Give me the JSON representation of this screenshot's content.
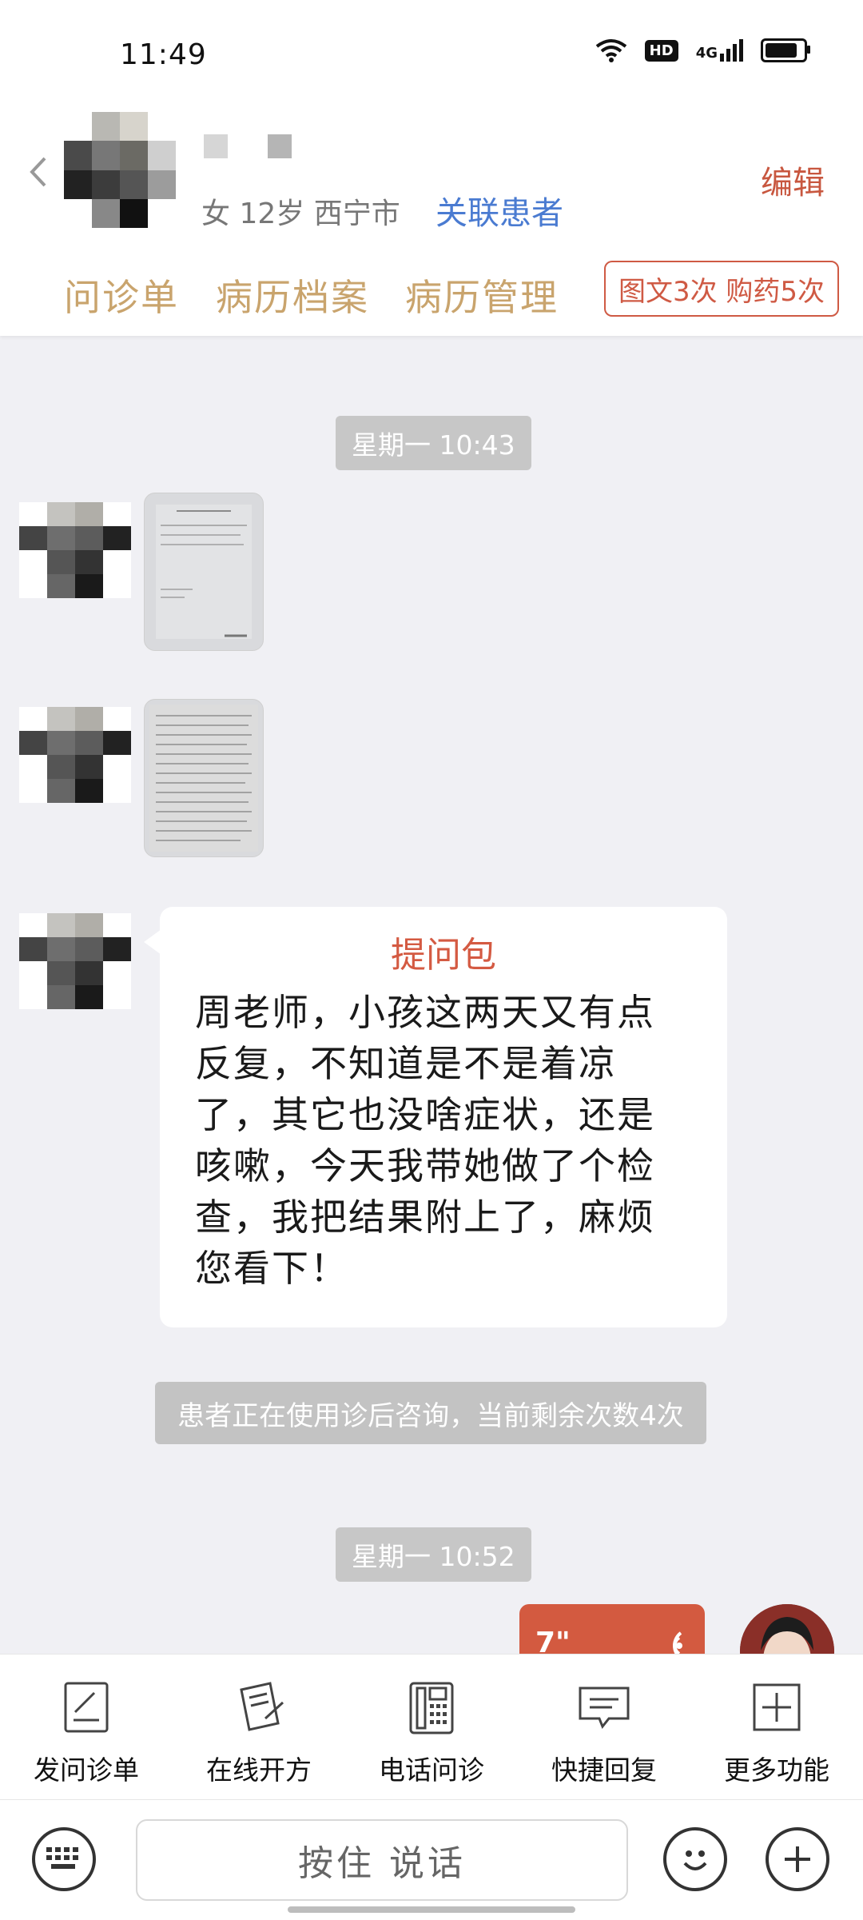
{
  "status_bar": {
    "time": "11:49",
    "hd_label": "HD",
    "network_label": "4G",
    "battery_level": 0.85
  },
  "header": {
    "patient_info": "女 12岁  西宁市",
    "link_patient": "关联患者",
    "edit_label": "编辑",
    "tabs": [
      "问诊单",
      "病历档案",
      "病历管理"
    ],
    "quota": "图文3次 购药5次"
  },
  "chat": {
    "time_label_1": "星期一 10:43",
    "message": {
      "title": "提问包",
      "text": "周老师，小孩这两天又有点反复，不知道是不是着凉了，其它也没啥症状，还是咳嗽，今天我带她做了个检查，我把结果附上了，麻烦您看下！"
    },
    "notice": "患者正在使用诊后咨询，当前剩余次数4次",
    "time_label_2": "星期一 10:52",
    "voice_duration": "7\""
  },
  "toolbar": {
    "items": [
      {
        "label": "发问诊单",
        "icon": "form-icon"
      },
      {
        "label": "在线开方",
        "icon": "prescription-icon"
      },
      {
        "label": "电话问诊",
        "icon": "phone-icon"
      },
      {
        "label": "快捷回复",
        "icon": "quick-reply-icon"
      },
      {
        "label": "更多功能",
        "icon": "more-icon"
      }
    ]
  },
  "input_bar": {
    "hold_to_talk": "按住 说话"
  },
  "colors": {
    "accent": "#c8573f",
    "tab_gold": "#c9a46d",
    "link_blue": "#4a7bd1",
    "chat_bg": "#f0f0f4"
  }
}
